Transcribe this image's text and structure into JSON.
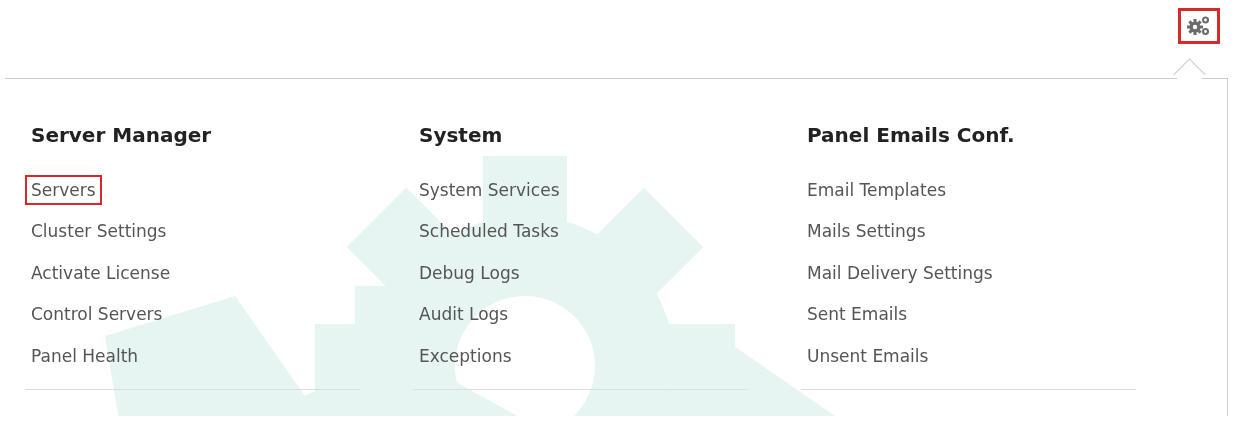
{
  "settings_button": {
    "highlighted": true
  },
  "columns": [
    {
      "heading": "Server Manager",
      "items": [
        {
          "label": "Servers",
          "highlighted": true
        },
        {
          "label": "Cluster Settings",
          "highlighted": false
        },
        {
          "label": "Activate License",
          "highlighted": false
        },
        {
          "label": "Control Servers",
          "highlighted": false
        },
        {
          "label": "Panel Health",
          "highlighted": false
        }
      ]
    },
    {
      "heading": "System",
      "items": [
        {
          "label": "System Services",
          "highlighted": false
        },
        {
          "label": "Scheduled Tasks",
          "highlighted": false
        },
        {
          "label": "Debug Logs",
          "highlighted": false
        },
        {
          "label": "Audit Logs",
          "highlighted": false
        },
        {
          "label": "Exceptions",
          "highlighted": false
        }
      ]
    },
    {
      "heading": "Panel Emails Conf.",
      "items": [
        {
          "label": "Email Templates",
          "highlighted": false
        },
        {
          "label": "Mails Settings",
          "highlighted": false
        },
        {
          "label": "Mail Delivery Settings",
          "highlighted": false
        },
        {
          "label": "Sent Emails",
          "highlighted": false
        },
        {
          "label": "Unsent Emails",
          "highlighted": false
        }
      ]
    }
  ]
}
